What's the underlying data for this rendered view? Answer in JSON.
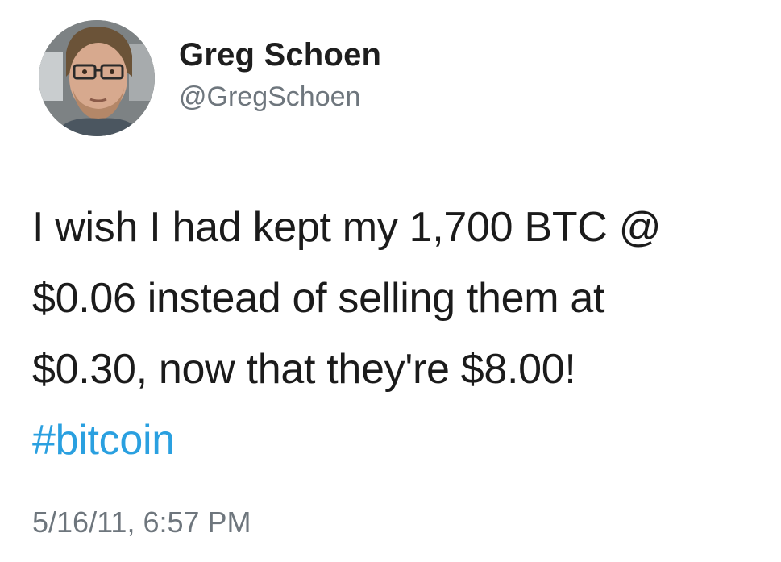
{
  "tweet": {
    "author": {
      "display_name": "Greg Schoen",
      "handle": "@GregSchoen",
      "avatar_icon": "profile-photo"
    },
    "text_lines": [
      "I wish I had kept my 1,700 BTC @",
      "$0.06 instead of selling them at",
      "$0.30, now that they're $8.00!"
    ],
    "hashtag": "#bitcoin",
    "timestamp": "5/16/11, 6:57 PM"
  },
  "colors": {
    "hashtag": "#2aa0e0",
    "secondary_text": "#6e767d",
    "primary_text": "#1b1b1b",
    "background": "#ffffff"
  }
}
